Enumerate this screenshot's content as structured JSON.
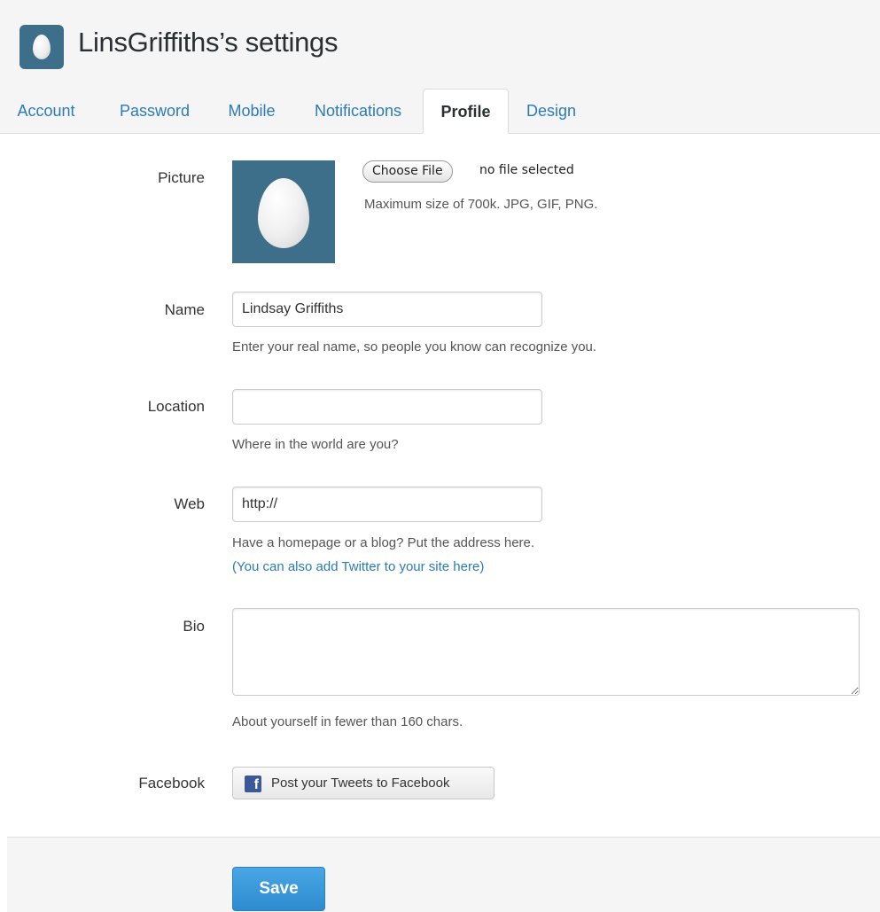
{
  "header": {
    "title": "LinsGriffiths’s settings",
    "avatar_icon": "egg-avatar-icon"
  },
  "tabs": [
    {
      "label": "Account",
      "active": false
    },
    {
      "label": "Password",
      "active": false
    },
    {
      "label": "Mobile",
      "active": false
    },
    {
      "label": "Notifications",
      "active": false
    },
    {
      "label": "Profile",
      "active": true
    },
    {
      "label": "Design",
      "active": false
    }
  ],
  "form": {
    "picture": {
      "label": "Picture",
      "choose_button": "Choose File",
      "file_status": "no file selected",
      "note": "Maximum size of 700k. JPG, GIF, PNG."
    },
    "name": {
      "label": "Name",
      "value": "Lindsay Griffiths",
      "help": "Enter your real name, so people you know can recognize you."
    },
    "location": {
      "label": "Location",
      "value": "",
      "help": "Where in the world are you?"
    },
    "web": {
      "label": "Web",
      "value": "http://",
      "help": "Have a homepage or a blog? Put the address here.",
      "link": "(You can also add Twitter to your site here)"
    },
    "bio": {
      "label": "Bio",
      "value": "",
      "help": "About yourself in fewer than 160 chars."
    },
    "facebook": {
      "label": "Facebook",
      "button": "Post your Tweets to Facebook",
      "icon": "facebook-icon",
      "icon_glyph": "f"
    }
  },
  "footer": {
    "save_label": "Save"
  },
  "colors": {
    "link": "#2b7bb9",
    "avatar_bg": "#3d6e8a",
    "save_button": "#2d8ccf",
    "facebook": "#3b5998"
  }
}
